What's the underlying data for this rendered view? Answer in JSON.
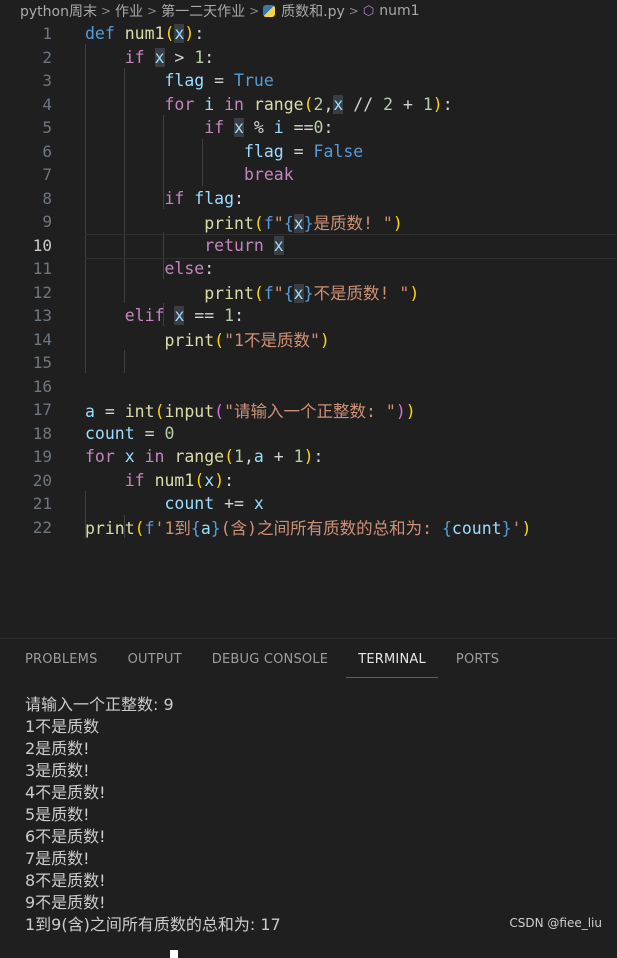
{
  "breadcrumb": {
    "items": [
      "python周末",
      "作业",
      "第一二天作业",
      "质数和.py",
      "num1"
    ]
  },
  "editor": {
    "line_numbers": [
      "1",
      "2",
      "3",
      "4",
      "5",
      "6",
      "7",
      "8",
      "9",
      "10",
      "11",
      "12",
      "13",
      "14",
      "15",
      "16",
      "17",
      "18",
      "19",
      "20",
      "21",
      "22"
    ],
    "active_line": "10"
  },
  "panel": {
    "tabs": [
      "PROBLEMS",
      "OUTPUT",
      "DEBUG CONSOLE",
      "TERMINAL",
      "PORTS"
    ],
    "active_tab": "TERMINAL",
    "terminal_lines": [
      "请输入一个正整数: 9",
      "1不是质数",
      "2是质数!",
      "3是质数!",
      "4不是质数!",
      "5是质数!",
      "6不是质数!",
      "7是质数!",
      "8不是质数!",
      "9不是质数!",
      "1到9(含)之间所有质数的总和为: 17"
    ]
  },
  "watermark": "CSDN @fiee_liu",
  "code": {
    "l1": {
      "def": "def",
      "name": "num1",
      "lp": "(",
      "x": "x",
      "rp": ")",
      "colon": ":"
    },
    "l2": {
      "if": "if",
      "x": "x",
      "op": " > ",
      "n": "1",
      "colon": ":"
    },
    "l3": {
      "v": "flag",
      "op": " = ",
      "val": "True"
    },
    "l4": {
      "for": "for",
      "i": "i",
      "in": "in",
      "range": "range",
      "lp": "(",
      "a": "2",
      "comma": ",",
      "x": "x",
      "op": " // ",
      "b": "2",
      "plus": " + ",
      "c": "1",
      "rp": ")",
      "colon": ":"
    },
    "l5": {
      "if": "if",
      "x": "x",
      "op": " % ",
      "i": "i",
      "eq": " ==",
      "n": "0",
      "colon": ":"
    },
    "l6": {
      "v": "flag",
      "op": " = ",
      "val": "False"
    },
    "l7": {
      "brk": "break"
    },
    "l8": {
      "if": "if",
      "v": "flag",
      "colon": ":"
    },
    "l9": {
      "print": "print",
      "lp": "(",
      "f": "f",
      "q1": "\"",
      "lb": "{",
      "x": "x",
      "rb": "}",
      "s": "是质数! ",
      "q2": "\"",
      "rp": ")"
    },
    "l10": {
      "ret": "return",
      "x": "x"
    },
    "l11": {
      "else": "else",
      "colon": ":"
    },
    "l12": {
      "print": "print",
      "lp": "(",
      "f": "f",
      "q1": "\"",
      "lb": "{",
      "x": "x",
      "rb": "}",
      "s": "不是质数! ",
      "q2": "\"",
      "rp": ")"
    },
    "l13": {
      "elif": "elif",
      "x": "x",
      "op": " == ",
      "n": "1",
      "colon": ":"
    },
    "l14": {
      "print": "print",
      "lp": "(",
      "s": "\"1不是质数\"",
      "rp": ")"
    },
    "l17": {
      "a": "a",
      "op": " = ",
      "int": "int",
      "lp1": "(",
      "input": "input",
      "lp2": "(",
      "s": "\"请输入一个正整数: \"",
      "rp2": ")",
      "rp1": ")"
    },
    "l18": {
      "v": "count",
      "op": " = ",
      "n": "0"
    },
    "l19": {
      "for": "for",
      "x": "x",
      "in": "in",
      "range": "range",
      "lp": "(",
      "a": "1",
      "comma": ",",
      "b": "a",
      "plus": " + ",
      "c": "1",
      "rp": ")",
      "colon": ":"
    },
    "l20": {
      "if": "if",
      "fn": "num1",
      "lp": "(",
      "x": "x",
      "rp": ")",
      "colon": ":"
    },
    "l21": {
      "v": "count",
      "op": " += ",
      "x": "x"
    },
    "l22": {
      "print": "print",
      "lp": "(",
      "f": "f",
      "q1": "'",
      "s1": "1到",
      "lb1": "{",
      "a": "a",
      "rb1": "}",
      "s2": "(含)之间所有质数的总和为: ",
      "lb2": "{",
      "c": "count",
      "rb2": "}",
      "q2": "'",
      "rp": ")"
    }
  }
}
